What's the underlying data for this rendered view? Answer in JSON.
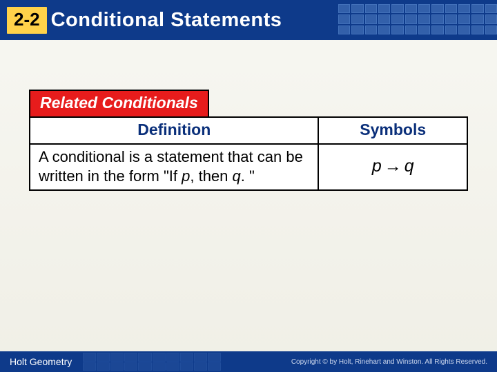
{
  "header": {
    "section_number": "2-2",
    "title": "Conditional Statements"
  },
  "caption": "Related Conditionals",
  "table": {
    "headers": {
      "definition": "Definition",
      "symbols": "Symbols"
    },
    "row": {
      "definition_pre": "A conditional is a statement that can be written in the form \"If ",
      "p": "p",
      "mid": ", then ",
      "q": "q",
      "post": ". \"",
      "sym_p": "p",
      "sym_arrow": "→",
      "sym_q": "q"
    }
  },
  "footer": {
    "book": "Holt Geometry",
    "copyright": "Copyright © by Holt, Rinehart and Winston. All Rights Reserved."
  }
}
